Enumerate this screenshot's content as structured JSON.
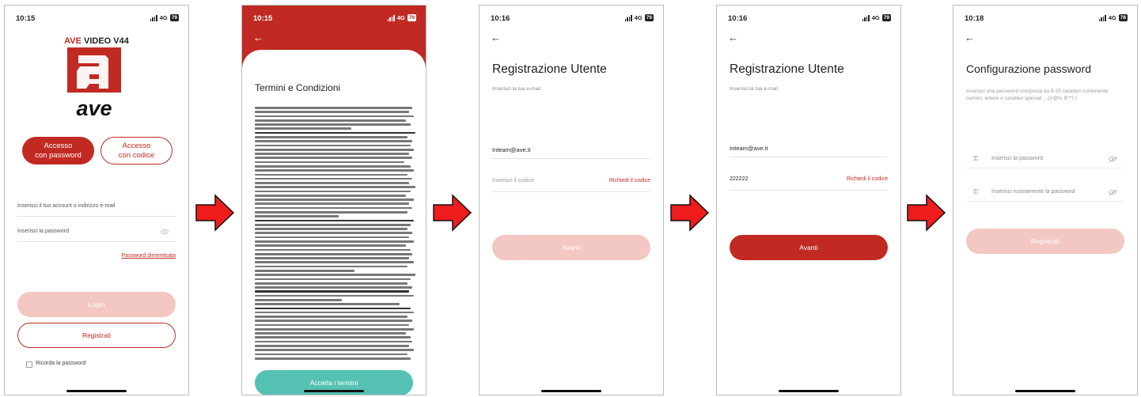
{
  "colors": {
    "brand_red": "#c12a22",
    "pale_red": "#f3c7c2",
    "accept_green": "#56c2b4"
  },
  "screens": [
    {
      "status": {
        "time": "10:15",
        "network": "4G",
        "battery": "79"
      },
      "brand_line": {
        "ave": "AVE",
        "rest": " VIDEO V44"
      },
      "logo_text": "ave",
      "toggle_password": "Accesso\ncon password",
      "toggle_code": "Accesso\ncon codice",
      "account_placeholder": "Inserisci il tuo account o indirizzo e-mail",
      "password_placeholder": "Inserisci la password",
      "forgot_password": "Password dimenticata",
      "login_button": "Login",
      "register_button": "Registrati",
      "remember_password": "Ricorda la password"
    },
    {
      "status": {
        "time": "10:15",
        "network": "4G",
        "battery": "79"
      },
      "title": "Termini e Condizioni",
      "accept_button": "Accetta i termini"
    },
    {
      "status": {
        "time": "10:16",
        "network": "4G",
        "battery": "79"
      },
      "title": "Registrazione Utente",
      "email_label": "Inserisci la tua e-mail",
      "email_value": "Inteam@ave.it",
      "code_placeholder": "Inserisci il codice",
      "request_code": "Richiedi il codice",
      "next_button": "Avanti"
    },
    {
      "status": {
        "time": "10:16",
        "network": "4G",
        "battery": "79"
      },
      "title": "Registrazione Utente",
      "email_label": "Inserisci la tua e-mail",
      "email_value": "Inteam@ave.it",
      "code_value": "222222",
      "request_code": "Richiedi il codice",
      "next_button": "Avanti"
    },
    {
      "status": {
        "time": "10:18",
        "network": "4G",
        "battery": "78"
      },
      "title": "Configurazione password",
      "description": "Inserisci una password composta da 8-25 caratteri contenente numeri, lettere e caratteri speciali _-()!@% $^*?./",
      "password_placeholder": "Inserisci la password",
      "confirm_placeholder": "Inserisci nuovamente la password",
      "register_button": "Registrati"
    }
  ]
}
